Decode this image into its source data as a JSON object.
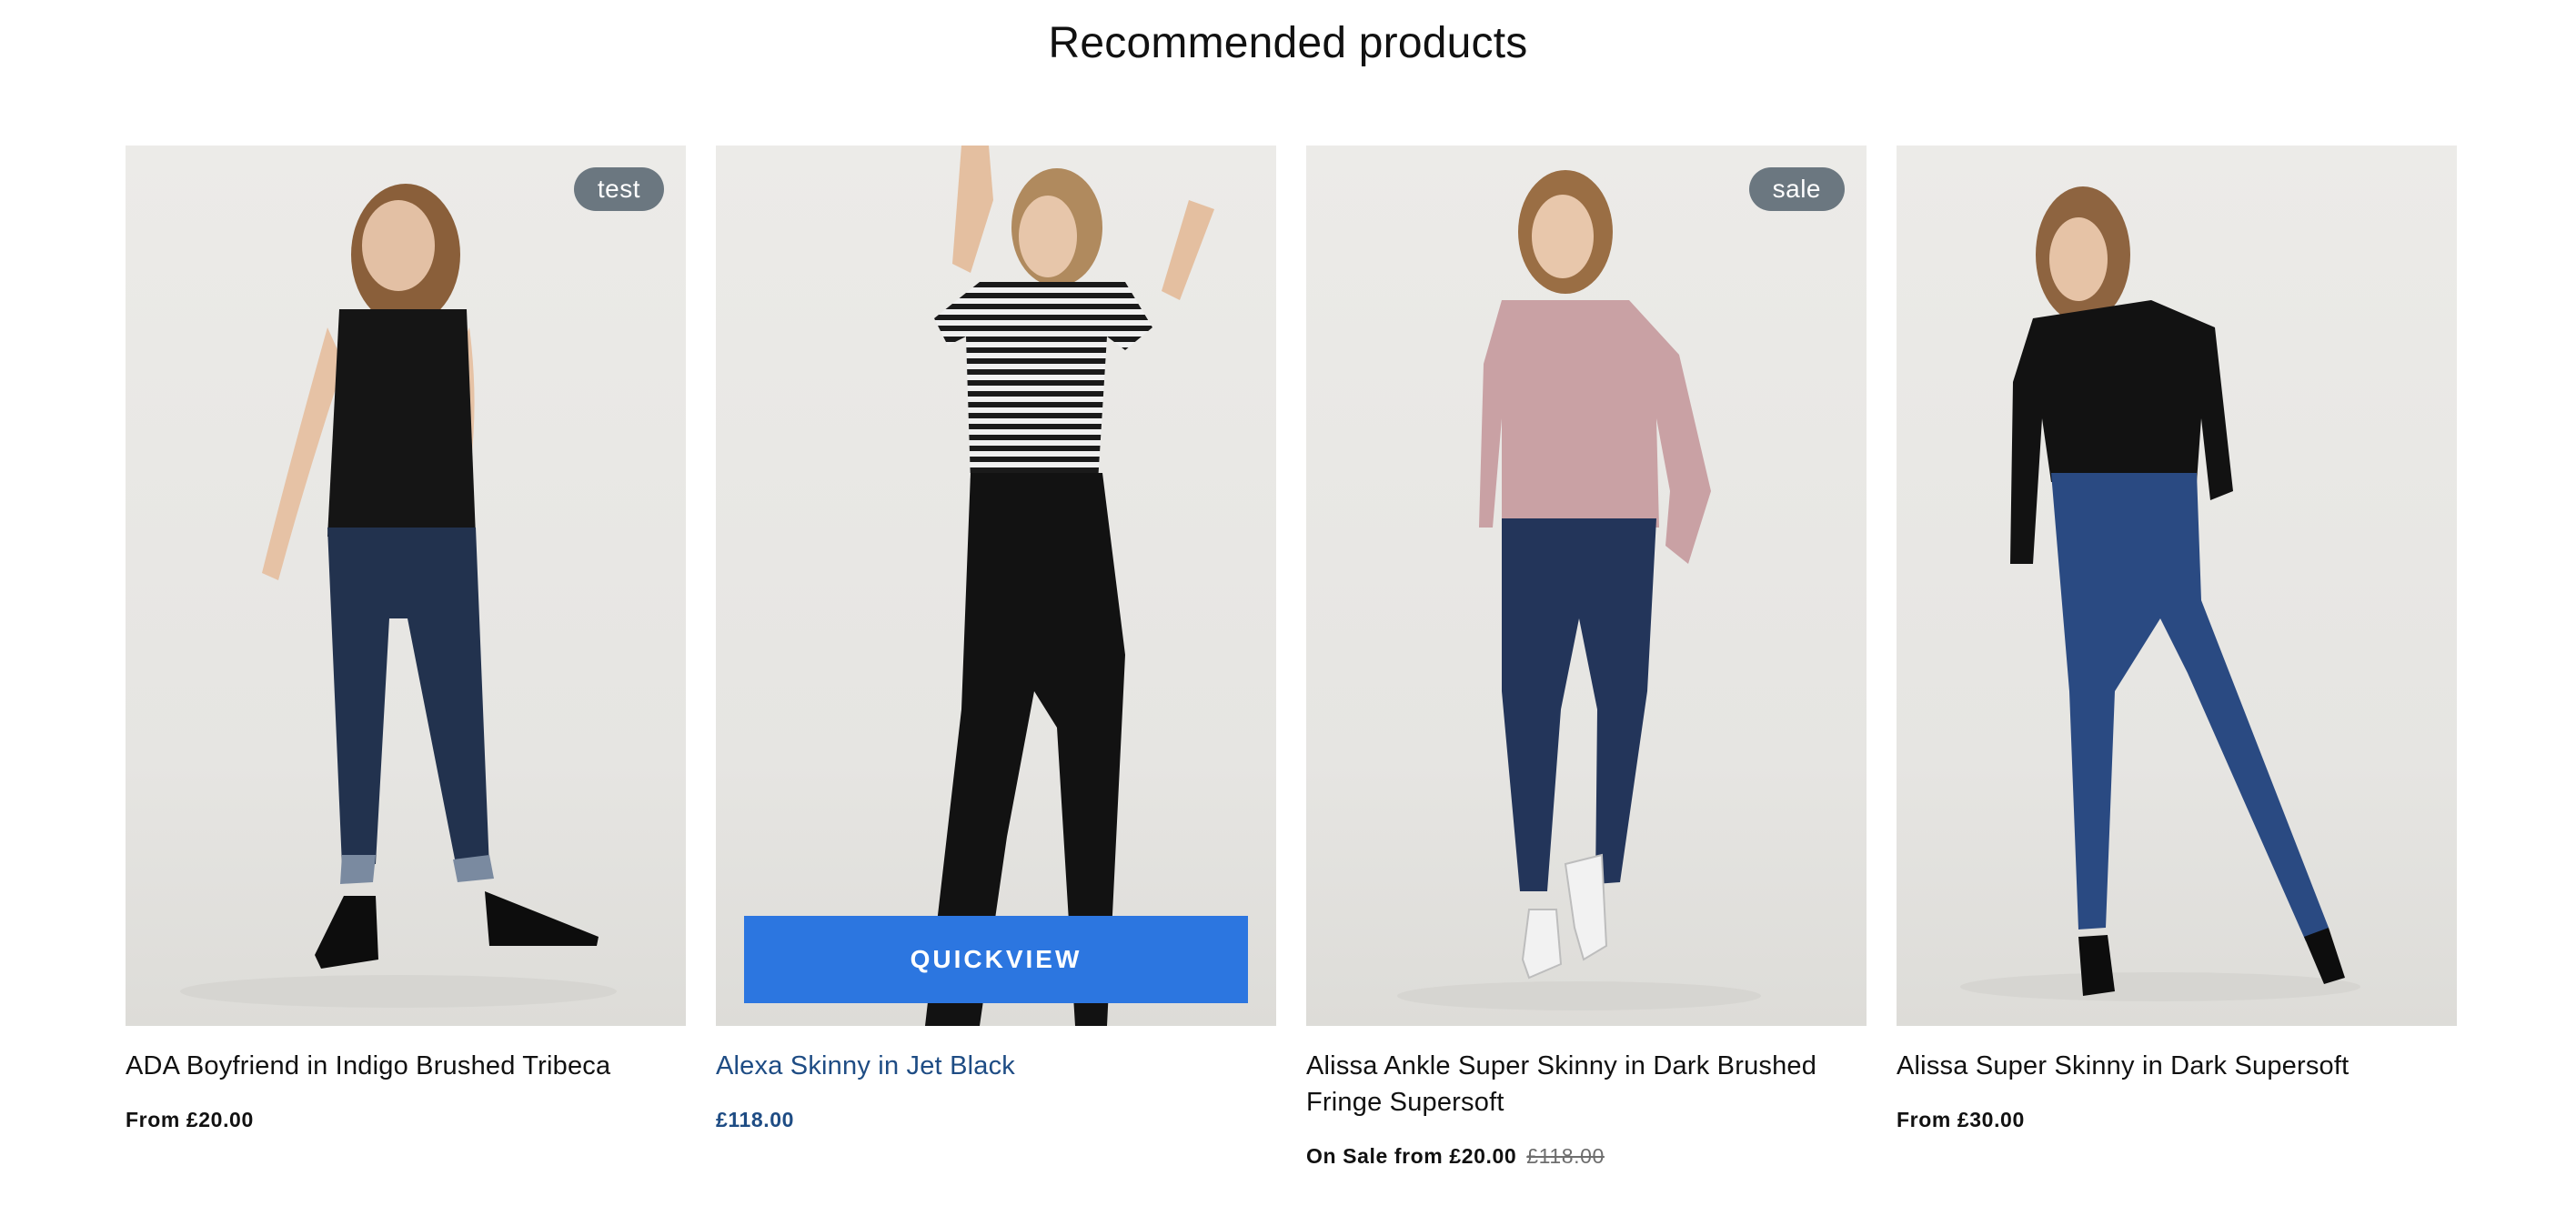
{
  "section": {
    "title": "Recommended products"
  },
  "colors": {
    "badge_bg": "#6b7780",
    "quickview_bg": "#2c76e0",
    "link_active": "#1e4c84",
    "background": "#ffffff"
  },
  "products": [
    {
      "title": "ADA Boyfriend in Indigo Brushed Tribeca",
      "price_text": "From £20.00",
      "badge": "test",
      "image_icon": "product-image-black-top-indigo-jeans"
    },
    {
      "title": "Alexa Skinny in Jet Black",
      "price_text": "£118.00",
      "quickview_label": "QUICKVIEW",
      "hovered": true,
      "image_icon": "product-image-striped-tee-black-jeans"
    },
    {
      "title": "Alissa Ankle Super Skinny in Dark Brushed Fringe Supersoft",
      "price_text": "On Sale from £20.00",
      "compare_price": "£118.00",
      "badge": "sale",
      "image_icon": "product-image-pink-sweater-dark-jeans"
    },
    {
      "title": "Alissa Super Skinny in Dark Supersoft",
      "price_text": "From £30.00",
      "image_icon": "product-image-black-cardigan-blue-jeans"
    }
  ]
}
